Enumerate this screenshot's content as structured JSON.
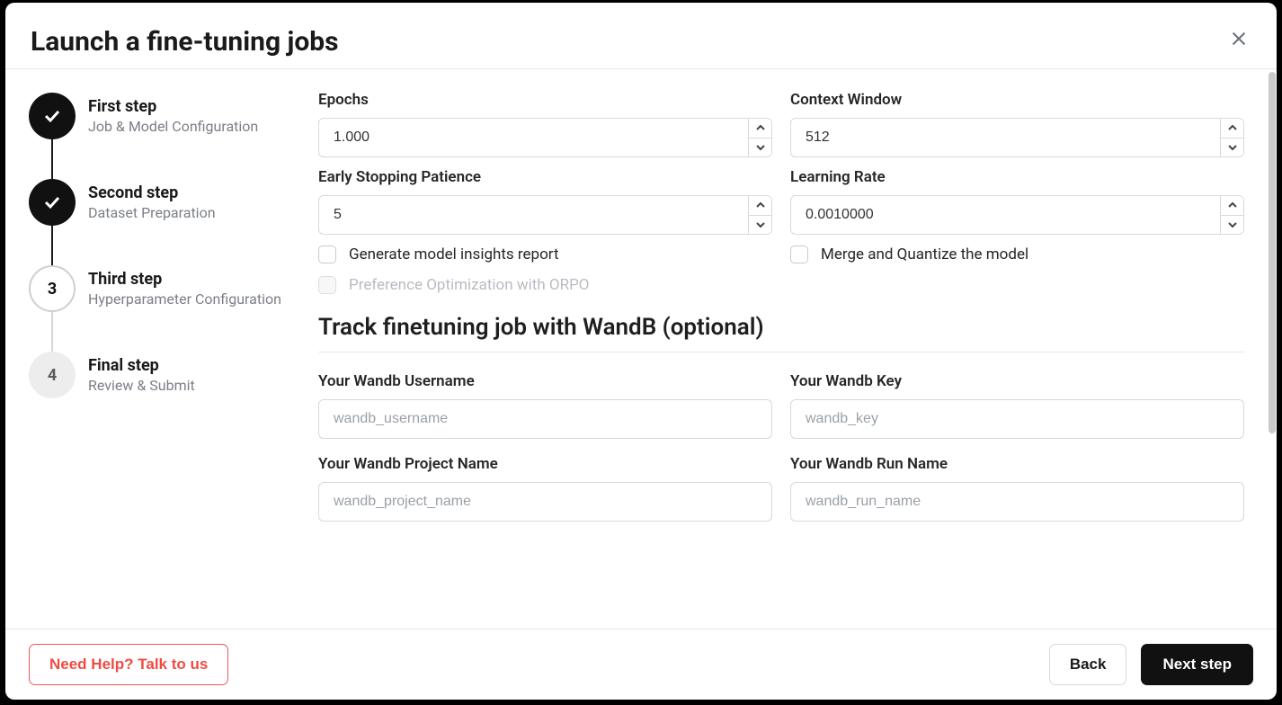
{
  "modal": {
    "title": "Launch a fine-tuning jobs"
  },
  "steps": [
    {
      "title": "First step",
      "sub": "Job & Model Configuration",
      "state": "done",
      "badge": ""
    },
    {
      "title": "Second step",
      "sub": "Dataset Preparation",
      "state": "done",
      "badge": ""
    },
    {
      "title": "Third step",
      "sub": "Hyperparameter Configuration",
      "state": "current",
      "badge": "3"
    },
    {
      "title": "Final step",
      "sub": "Review & Submit",
      "state": "pending",
      "badge": "4"
    }
  ],
  "form": {
    "epochs": {
      "label": "Epochs",
      "value": "1.000"
    },
    "context_window": {
      "label": "Context Window",
      "value": "512"
    },
    "early_stop": {
      "label": "Early Stopping Patience",
      "value": "5"
    },
    "learning_rate": {
      "label": "Learning Rate",
      "value": "0.0010000"
    },
    "chk_insights": {
      "label": "Generate model insights report",
      "checked": false
    },
    "chk_merge": {
      "label": "Merge and Quantize the model",
      "checked": false
    },
    "chk_orpo": {
      "label": "Preference Optimization with ORPO",
      "checked": false,
      "disabled": true
    },
    "wandb_section": "Track finetuning job with WandB (optional)",
    "wandb_user": {
      "label": "Your Wandb Username",
      "placeholder": "wandb_username",
      "value": ""
    },
    "wandb_key": {
      "label": "Your Wandb Key",
      "placeholder": "wandb_key",
      "value": ""
    },
    "wandb_project": {
      "label": "Your Wandb Project Name",
      "placeholder": "wandb_project_name",
      "value": ""
    },
    "wandb_run": {
      "label": "Your Wandb Run Name",
      "placeholder": "wandb_run_name",
      "value": ""
    }
  },
  "footer": {
    "help": "Need Help? Talk to us",
    "back": "Back",
    "next": "Next step"
  }
}
